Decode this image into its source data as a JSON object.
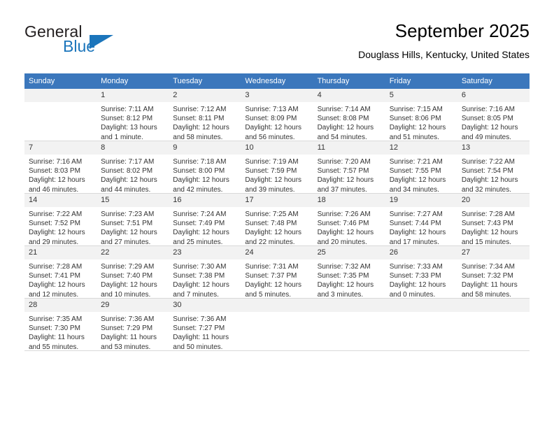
{
  "brand": {
    "name_part1": "General",
    "name_part2": "Blue",
    "accent_color": "#1b75bb"
  },
  "header": {
    "title": "September 2025",
    "subtitle": "Douglass Hills, Kentucky, United States",
    "header_bg_color": "#3b77bc"
  },
  "calendar": {
    "weekday_headers": [
      "Sunday",
      "Monday",
      "Tuesday",
      "Wednesday",
      "Thursday",
      "Friday",
      "Saturday"
    ],
    "weeks": [
      [
        {
          "day": "",
          "sunrise": "",
          "sunset": "",
          "daylight1": "",
          "daylight2": ""
        },
        {
          "day": "1",
          "sunrise": "Sunrise: 7:11 AM",
          "sunset": "Sunset: 8:12 PM",
          "daylight1": "Daylight: 13 hours",
          "daylight2": "and 1 minute."
        },
        {
          "day": "2",
          "sunrise": "Sunrise: 7:12 AM",
          "sunset": "Sunset: 8:11 PM",
          "daylight1": "Daylight: 12 hours",
          "daylight2": "and 58 minutes."
        },
        {
          "day": "3",
          "sunrise": "Sunrise: 7:13 AM",
          "sunset": "Sunset: 8:09 PM",
          "daylight1": "Daylight: 12 hours",
          "daylight2": "and 56 minutes."
        },
        {
          "day": "4",
          "sunrise": "Sunrise: 7:14 AM",
          "sunset": "Sunset: 8:08 PM",
          "daylight1": "Daylight: 12 hours",
          "daylight2": "and 54 minutes."
        },
        {
          "day": "5",
          "sunrise": "Sunrise: 7:15 AM",
          "sunset": "Sunset: 8:06 PM",
          "daylight1": "Daylight: 12 hours",
          "daylight2": "and 51 minutes."
        },
        {
          "day": "6",
          "sunrise": "Sunrise: 7:16 AM",
          "sunset": "Sunset: 8:05 PM",
          "daylight1": "Daylight: 12 hours",
          "daylight2": "and 49 minutes."
        }
      ],
      [
        {
          "day": "7",
          "sunrise": "Sunrise: 7:16 AM",
          "sunset": "Sunset: 8:03 PM",
          "daylight1": "Daylight: 12 hours",
          "daylight2": "and 46 minutes."
        },
        {
          "day": "8",
          "sunrise": "Sunrise: 7:17 AM",
          "sunset": "Sunset: 8:02 PM",
          "daylight1": "Daylight: 12 hours",
          "daylight2": "and 44 minutes."
        },
        {
          "day": "9",
          "sunrise": "Sunrise: 7:18 AM",
          "sunset": "Sunset: 8:00 PM",
          "daylight1": "Daylight: 12 hours",
          "daylight2": "and 42 minutes."
        },
        {
          "day": "10",
          "sunrise": "Sunrise: 7:19 AM",
          "sunset": "Sunset: 7:59 PM",
          "daylight1": "Daylight: 12 hours",
          "daylight2": "and 39 minutes."
        },
        {
          "day": "11",
          "sunrise": "Sunrise: 7:20 AM",
          "sunset": "Sunset: 7:57 PM",
          "daylight1": "Daylight: 12 hours",
          "daylight2": "and 37 minutes."
        },
        {
          "day": "12",
          "sunrise": "Sunrise: 7:21 AM",
          "sunset": "Sunset: 7:55 PM",
          "daylight1": "Daylight: 12 hours",
          "daylight2": "and 34 minutes."
        },
        {
          "day": "13",
          "sunrise": "Sunrise: 7:22 AM",
          "sunset": "Sunset: 7:54 PM",
          "daylight1": "Daylight: 12 hours",
          "daylight2": "and 32 minutes."
        }
      ],
      [
        {
          "day": "14",
          "sunrise": "Sunrise: 7:22 AM",
          "sunset": "Sunset: 7:52 PM",
          "daylight1": "Daylight: 12 hours",
          "daylight2": "and 29 minutes."
        },
        {
          "day": "15",
          "sunrise": "Sunrise: 7:23 AM",
          "sunset": "Sunset: 7:51 PM",
          "daylight1": "Daylight: 12 hours",
          "daylight2": "and 27 minutes."
        },
        {
          "day": "16",
          "sunrise": "Sunrise: 7:24 AM",
          "sunset": "Sunset: 7:49 PM",
          "daylight1": "Daylight: 12 hours",
          "daylight2": "and 25 minutes."
        },
        {
          "day": "17",
          "sunrise": "Sunrise: 7:25 AM",
          "sunset": "Sunset: 7:48 PM",
          "daylight1": "Daylight: 12 hours",
          "daylight2": "and 22 minutes."
        },
        {
          "day": "18",
          "sunrise": "Sunrise: 7:26 AM",
          "sunset": "Sunset: 7:46 PM",
          "daylight1": "Daylight: 12 hours",
          "daylight2": "and 20 minutes."
        },
        {
          "day": "19",
          "sunrise": "Sunrise: 7:27 AM",
          "sunset": "Sunset: 7:44 PM",
          "daylight1": "Daylight: 12 hours",
          "daylight2": "and 17 minutes."
        },
        {
          "day": "20",
          "sunrise": "Sunrise: 7:28 AM",
          "sunset": "Sunset: 7:43 PM",
          "daylight1": "Daylight: 12 hours",
          "daylight2": "and 15 minutes."
        }
      ],
      [
        {
          "day": "21",
          "sunrise": "Sunrise: 7:28 AM",
          "sunset": "Sunset: 7:41 PM",
          "daylight1": "Daylight: 12 hours",
          "daylight2": "and 12 minutes."
        },
        {
          "day": "22",
          "sunrise": "Sunrise: 7:29 AM",
          "sunset": "Sunset: 7:40 PM",
          "daylight1": "Daylight: 12 hours",
          "daylight2": "and 10 minutes."
        },
        {
          "day": "23",
          "sunrise": "Sunrise: 7:30 AM",
          "sunset": "Sunset: 7:38 PM",
          "daylight1": "Daylight: 12 hours",
          "daylight2": "and 7 minutes."
        },
        {
          "day": "24",
          "sunrise": "Sunrise: 7:31 AM",
          "sunset": "Sunset: 7:37 PM",
          "daylight1": "Daylight: 12 hours",
          "daylight2": "and 5 minutes."
        },
        {
          "day": "25",
          "sunrise": "Sunrise: 7:32 AM",
          "sunset": "Sunset: 7:35 PM",
          "daylight1": "Daylight: 12 hours",
          "daylight2": "and 3 minutes."
        },
        {
          "day": "26",
          "sunrise": "Sunrise: 7:33 AM",
          "sunset": "Sunset: 7:33 PM",
          "daylight1": "Daylight: 12 hours",
          "daylight2": "and 0 minutes."
        },
        {
          "day": "27",
          "sunrise": "Sunrise: 7:34 AM",
          "sunset": "Sunset: 7:32 PM",
          "daylight1": "Daylight: 11 hours",
          "daylight2": "and 58 minutes."
        }
      ],
      [
        {
          "day": "28",
          "sunrise": "Sunrise: 7:35 AM",
          "sunset": "Sunset: 7:30 PM",
          "daylight1": "Daylight: 11 hours",
          "daylight2": "and 55 minutes."
        },
        {
          "day": "29",
          "sunrise": "Sunrise: 7:36 AM",
          "sunset": "Sunset: 7:29 PM",
          "daylight1": "Daylight: 11 hours",
          "daylight2": "and 53 minutes."
        },
        {
          "day": "30",
          "sunrise": "Sunrise: 7:36 AM",
          "sunset": "Sunset: 7:27 PM",
          "daylight1": "Daylight: 11 hours",
          "daylight2": "and 50 minutes."
        },
        {
          "day": "",
          "sunrise": "",
          "sunset": "",
          "daylight1": "",
          "daylight2": ""
        },
        {
          "day": "",
          "sunrise": "",
          "sunset": "",
          "daylight1": "",
          "daylight2": ""
        },
        {
          "day": "",
          "sunrise": "",
          "sunset": "",
          "daylight1": "",
          "daylight2": ""
        },
        {
          "day": "",
          "sunrise": "",
          "sunset": "",
          "daylight1": "",
          "daylight2": ""
        }
      ]
    ]
  }
}
